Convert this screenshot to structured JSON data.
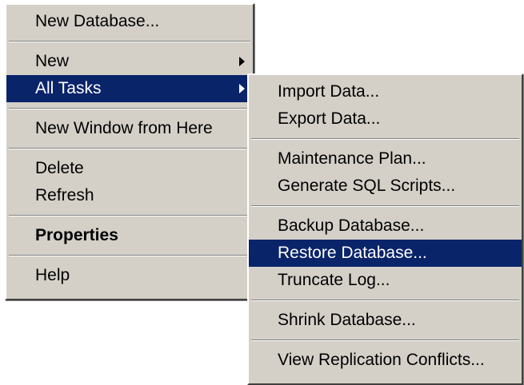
{
  "main_menu": {
    "items": [
      {
        "label": "New Database..."
      },
      {
        "label": "New"
      },
      {
        "label": "All Tasks"
      },
      {
        "label": "New Window from Here"
      },
      {
        "label": "Delete"
      },
      {
        "label": "Refresh"
      },
      {
        "label": "Properties"
      },
      {
        "label": "Help"
      }
    ]
  },
  "sub_menu": {
    "items": [
      {
        "label": "Import Data..."
      },
      {
        "label": "Export Data..."
      },
      {
        "label": "Maintenance Plan..."
      },
      {
        "label": "Generate SQL Scripts..."
      },
      {
        "label": "Backup Database..."
      },
      {
        "label": "Restore Database..."
      },
      {
        "label": "Truncate Log..."
      },
      {
        "label": "Shrink Database..."
      },
      {
        "label": "View Replication Conflicts..."
      }
    ]
  },
  "colors": {
    "menu_bg": "#d4d0c8",
    "highlight_bg": "#0a246a",
    "highlight_text": "#ffffff"
  }
}
